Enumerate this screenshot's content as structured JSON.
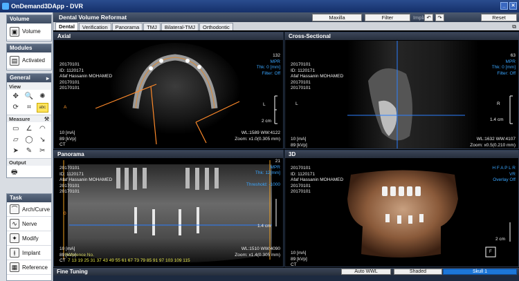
{
  "app": {
    "title": "OnDemand3DApp - DVR"
  },
  "left": {
    "volume": {
      "header": "Volume",
      "button": "Volume"
    },
    "modules": {
      "header": "Modules",
      "button": "Activated"
    },
    "general": {
      "header": "General",
      "view_label": "View",
      "measure_label": "Measure",
      "output_label": "Output",
      "text_tool": "abc"
    },
    "task": {
      "header": "Task",
      "items": [
        "Arch/Curve",
        "Nerve",
        "Modify",
        "Implant",
        "Reference"
      ]
    }
  },
  "header": {
    "title": "Dental Volume Reformat",
    "maxilla": "Maxilla",
    "filter": "Filter",
    "implant": "Implant :",
    "reset": "Reset"
  },
  "tabs": [
    "Dental",
    "Verification",
    "Panorama",
    "TMJ",
    "Bilateral-TMJ",
    "Orthodontic"
  ],
  "viewports": {
    "axial": {
      "title": "Axial",
      "info": [
        "20170101",
        "ID: 1120171",
        "Afaf Hassanin MOHAMED",
        "20170101",
        "20170101"
      ],
      "slice": "132",
      "mpr": "MPR",
      "thk": "Thk: 0 [mm]",
      "filter": "Filter: Off",
      "orient": "L",
      "scale": "2 cm",
      "ma": "10 [mA]",
      "kvp": "89 [kVp]",
      "ct": "CT",
      "wl": "WL:1589 WW:4122",
      "zoom": "Zoom: x1.0(0.305 mm)",
      "marker": "A"
    },
    "cross": {
      "title": "Cross-Sectional",
      "slice": "63",
      "mpr": "MPR",
      "thk": "Thk: 0 [mm]",
      "filter": "Filter: Off",
      "info": [
        "20170101",
        "ID: 1120171",
        "Afaf Hassanin MOHAMED",
        "20170101",
        "20170101"
      ],
      "orient": "L",
      "side": "R",
      "scale": "1.4 cm",
      "ma": "10 [mA]",
      "kvp": "89 [kVp]",
      "ct": "CT",
      "wl": "WL:1632 WW:4107",
      "zoom": "Zoom: x0.5(0.210 mm)"
    },
    "panorama": {
      "title": "Panorama",
      "slice": "21",
      "mpr": "MPR",
      "thk": "Thk: 12[mm]",
      "threshold": "Threshold: -1000",
      "info": [
        "20170101",
        "ID: 1120171",
        "Afaf Hassanin MOHAMED",
        "20170101",
        "20170101"
      ],
      "scale": "1.4 cm",
      "ma": "10 [mA]",
      "kvp": "89 [kVp]",
      "ct": "CT",
      "wl": "WL:1510 WW:4090",
      "zoom": "Zoom: x1.4(0.305 mm)",
      "ruler_label": "Reference No.",
      "ruler": "7  13  19  25  31  37  43  49  55  61  67  73  79  85  91  97  103  109  115",
      "marker": "0"
    },
    "threed": {
      "title": "3D",
      "info": [
        "20170101",
        "ID: 1120171",
        "Afaf Hassanin MOHAMED",
        "20170101",
        "20170101"
      ],
      "orient": "H F A P L R",
      "vr": "VR",
      "overlay": "Overlay Off",
      "scale": "2 cm",
      "ma": "10 [mA]",
      "kvp": "89 [kVp]",
      "ct": "CT",
      "cube": "F"
    }
  },
  "bottom": {
    "fine_tuning": "Fine Tuning",
    "auto_wwl": "Auto WWL",
    "shaded": "Shaded",
    "preset": "Skull 1"
  }
}
